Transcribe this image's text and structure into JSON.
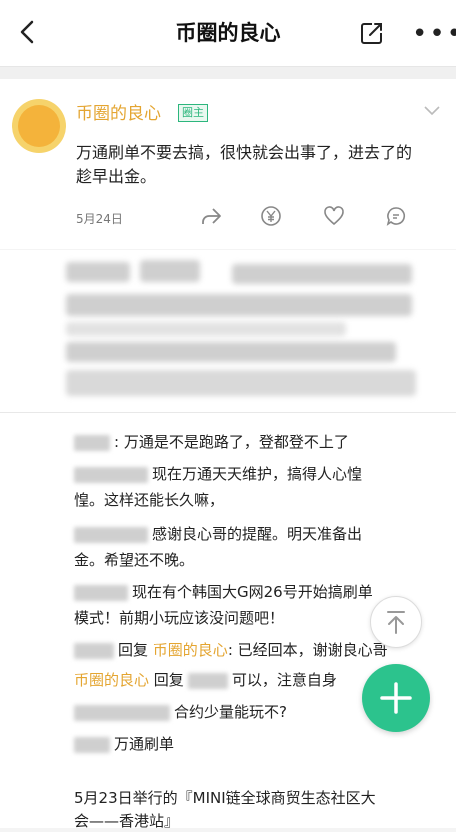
{
  "header": {
    "title": "币圈的良心"
  },
  "post": {
    "author": "币圈的良心",
    "badge": "圈主",
    "content": "万通刷单不要去搞，很快就会出事了，进去了的趁早出金。",
    "date": "5月24日"
  },
  "comments": [
    {
      "text": ": 万通是不是跑路了，登都登不上了"
    },
    {
      "text": "现在万通天天维护，搞得人心惶"
    },
    {
      "text": "惶。这样还能长久嘛，"
    },
    {
      "text": "感谢良心哥的提醒。明天准备出"
    },
    {
      "text": "金。希望还不晚。"
    },
    {
      "text": "现在有个韩国大G网26号开始搞刷单"
    },
    {
      "text": "模式！前期小玩应该没问题吧！"
    },
    {
      "reply_word": "回复",
      "reply_to": "币圈的良心",
      "text": ": 已经回本，谢谢良心哥"
    },
    {
      "author": "币圈的良心",
      "reply_word": "回复",
      "text": "可以，注意自身"
    },
    {
      "text": "合约少量能玩不?"
    },
    {
      "text": "万通刷单"
    }
  ],
  "footer": {
    "line1": "5月23日举行的『MINI链全球商贸生态社区大",
    "line2": "会——香港站』"
  },
  "colors": {
    "accent_green": "#2cc38d",
    "author_gold": "#e4a531"
  }
}
